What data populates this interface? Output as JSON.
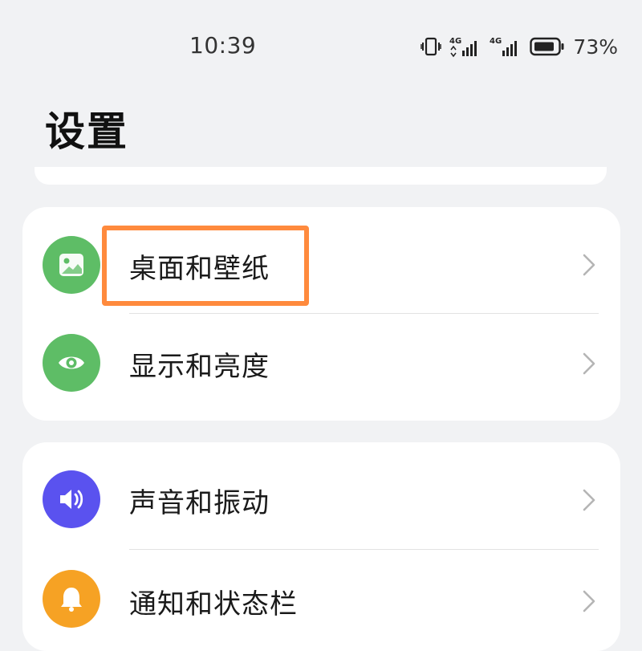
{
  "status_bar": {
    "time": "10:39",
    "battery_percent": "73%",
    "network_labels": [
      "4G",
      "4G"
    ],
    "icons": [
      "vibrate-icon",
      "signal-4g-icon",
      "signal-4g-icon",
      "battery-icon"
    ]
  },
  "page": {
    "title": "设置"
  },
  "groups": [
    {
      "items": [
        {
          "label": "桌面和壁纸",
          "icon": "wallpaper-icon",
          "icon_color": "#5ebd66",
          "highlighted": true
        },
        {
          "label": "显示和亮度",
          "icon": "eye-icon",
          "icon_color": "#5ebd66"
        }
      ]
    },
    {
      "items": [
        {
          "label": "声音和振动",
          "icon": "speaker-icon",
          "icon_color": "#5a52ef"
        },
        {
          "label": "通知和状态栏",
          "icon": "bell-icon",
          "icon_color": "#f6a224"
        }
      ]
    }
  ],
  "colors": {
    "background": "#f1f2f4",
    "card": "#ffffff",
    "highlight_outline": "#ff8a3d"
  }
}
